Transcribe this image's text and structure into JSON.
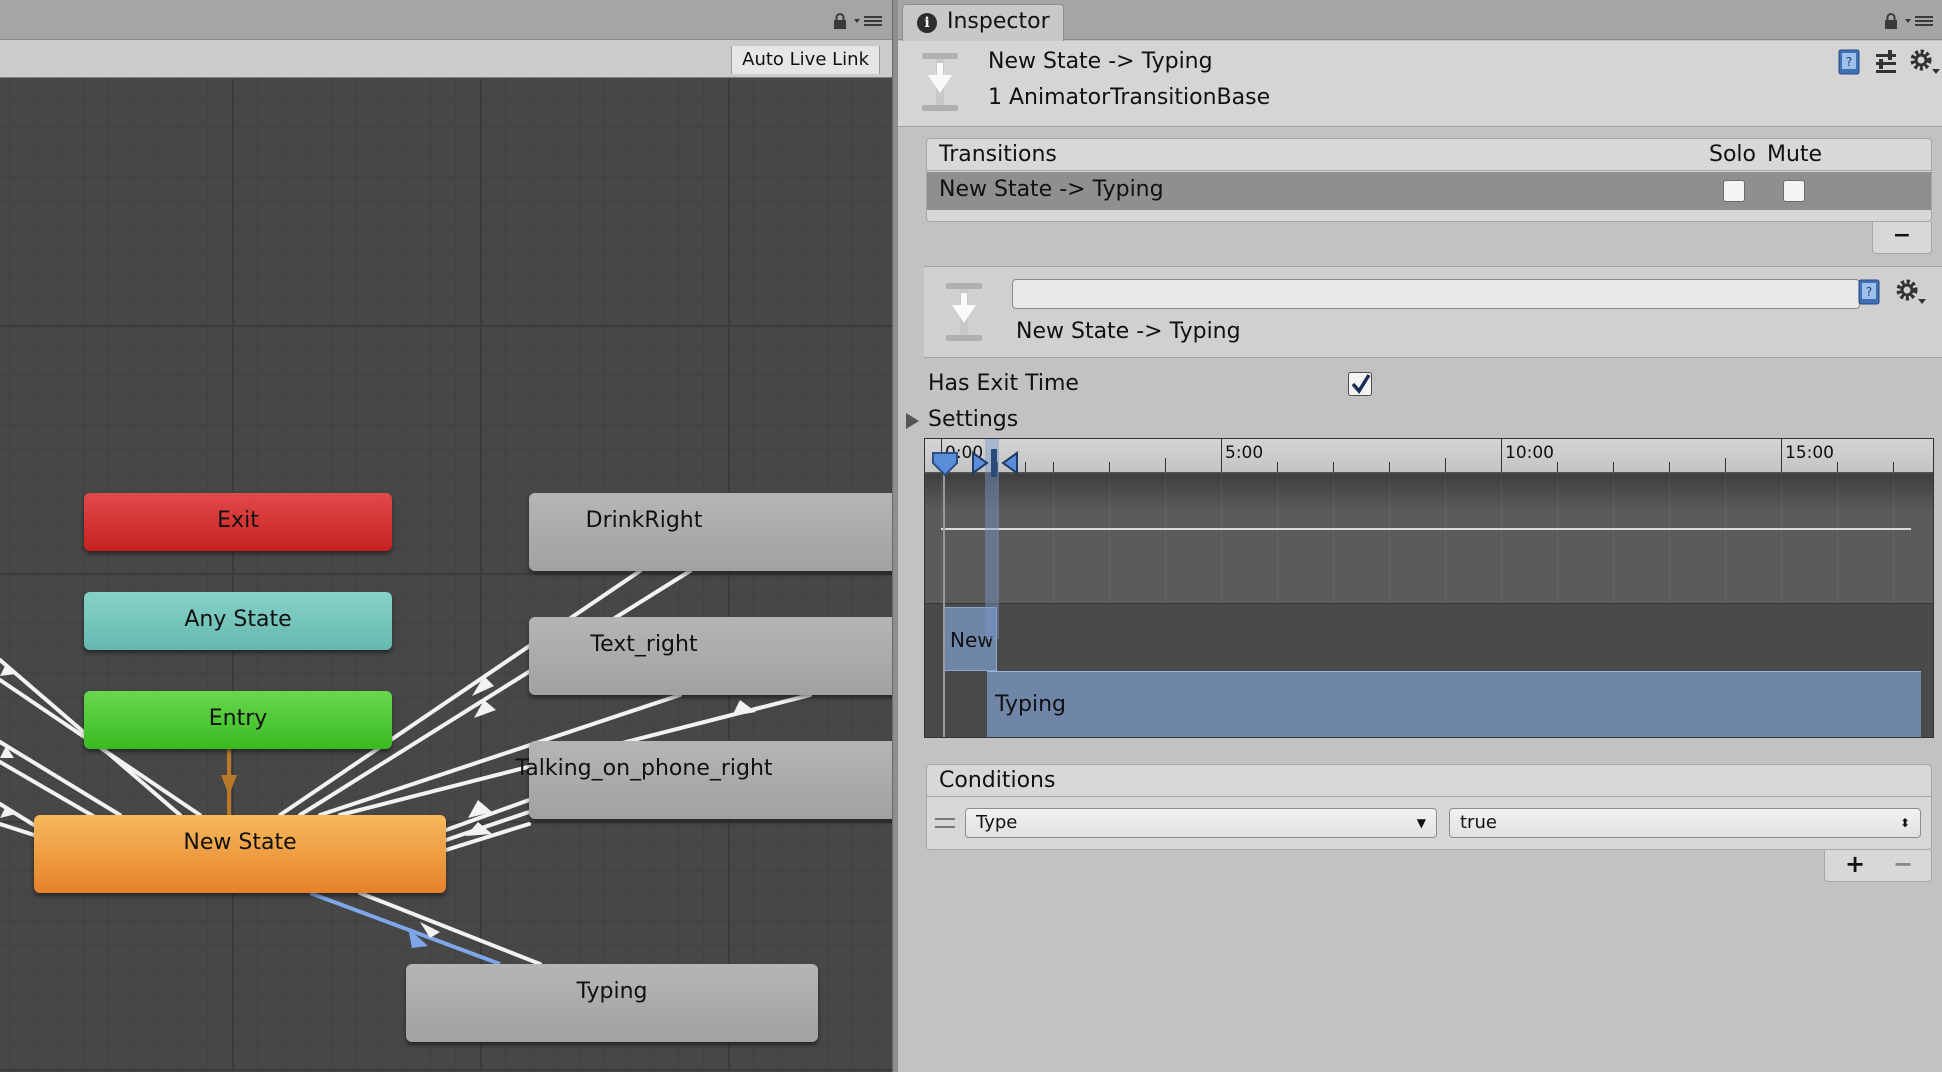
{
  "animator": {
    "toolbar": {
      "auto_live_link": "Auto Live Link"
    },
    "nodes": {
      "exit": "Exit",
      "any_state": "Any State",
      "entry": "Entry",
      "new_state": "New State",
      "drink_right": "DrinkRight",
      "text_right": "Text_right",
      "talking_on_phone_right": "Talking_on_phone_right",
      "typing": "Typing"
    },
    "colors": {
      "exit": "#d63636",
      "any_state": "#76c6bc",
      "entry": "#4ccb35",
      "new_state": "#f0a040",
      "state": "#aaaaaa",
      "selected_transition": "#7ea6e8"
    }
  },
  "inspector": {
    "tab_label": "Inspector",
    "header": {
      "title": "New State -> Typing",
      "subtitle": "1 AnimatorTransitionBase"
    },
    "transitions": {
      "title": "Transitions",
      "solo_label": "Solo",
      "mute_label": "Mute",
      "rows": [
        {
          "label": "New State -> Typing"
        }
      ],
      "remove_label": "−"
    },
    "selected": {
      "name_value": "",
      "label": "New State -> Typing"
    },
    "has_exit_time": {
      "label": "Has Exit Time"
    },
    "settings": {
      "label": "Settings"
    },
    "timeline": {
      "ticks": [
        "0:00",
        "5:00",
        "10:00",
        "15:00"
      ],
      "bars": {
        "from": "New",
        "to": "Typing"
      }
    },
    "conditions": {
      "title": "Conditions",
      "parameter": "Type",
      "value": "true",
      "add_label": "+",
      "remove_label": "−"
    }
  }
}
